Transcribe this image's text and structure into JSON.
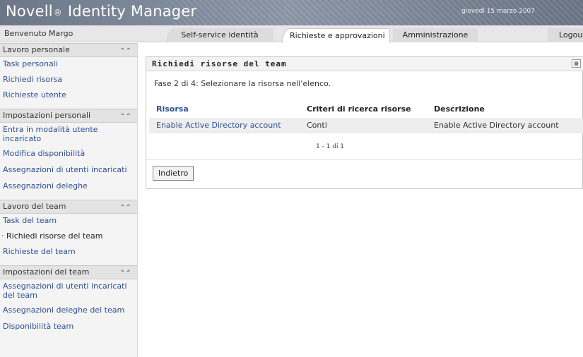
{
  "header": {
    "brand": "Novell",
    "brand_reg": "®",
    "brand_product": "Identity Manager",
    "date": "giovedì 15 marzo 2007",
    "welcome": "Benvenuto Margo"
  },
  "tabs": [
    {
      "label": "Self-service identità"
    },
    {
      "label": "Richieste e approvazioni",
      "active": true
    },
    {
      "label": "Amministrazione"
    },
    {
      "label": "Logout"
    }
  ],
  "sidebar": {
    "sections": [
      {
        "title": "Lavoro personale",
        "items": [
          "Task personali",
          "Richiedi risorsa",
          "Richieste utente"
        ]
      },
      {
        "title": "Impostazioni personali",
        "items": [
          "Entra in modalità utente incaricato",
          "Modifica disponibilità",
          "Assegnazioni di utenti incaricati",
          "Assegnazioni deleghe"
        ]
      },
      {
        "title": "Lavoro del team",
        "items": [
          "Task del team",
          "Richiedi risorse del team",
          "Richieste del team"
        ],
        "current_index": 1
      },
      {
        "title": "Impostazioni del team",
        "items": [
          "Assegnazioni di utenti incaricati del team",
          "Assegnazioni deleghe del team",
          "Disponibilità team"
        ]
      }
    ]
  },
  "panel": {
    "title": "Richiedi risorse del team",
    "step_text": "Fase 2 di 4: Selezionare la risorsa nell'elenco.",
    "columns": [
      "Risorsa",
      "Criteri di ricerca risorse",
      "Descrizione"
    ],
    "rows": [
      [
        "Enable Active Directory account",
        "Conti",
        "Enable Active Directory account"
      ]
    ],
    "pager": "1 - 1 di 1",
    "back_label": "Indietro"
  },
  "icons": {
    "collapse": "double-chevron-up-icon",
    "panel_menu": "grid-menu-icon"
  },
  "colors": {
    "link": "#2c4f93",
    "banner": "#7f8a9b"
  }
}
